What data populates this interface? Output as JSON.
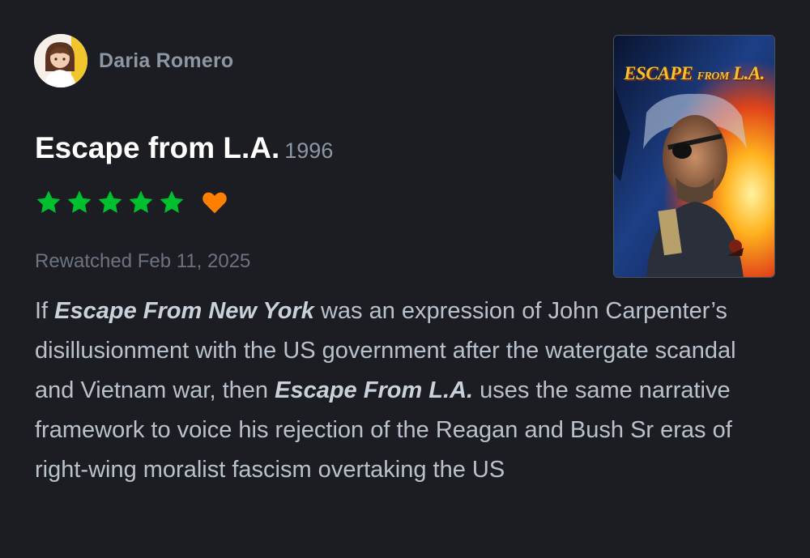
{
  "review": {
    "author": "Daria Romero",
    "film_title": "Escape from L.A.",
    "year": "1996",
    "rating_stars": 5,
    "liked": true,
    "watch_status": "Rewatched Feb 11, 2025",
    "body": {
      "p1": "If ",
      "b1": "Escape From New York",
      "p2": " was an expression of John Carpenter’s disillusionment with the US government after the watergate scandal and Vietnam war, then ",
      "b2": "Escape From L.A.",
      "p3": " uses the same narrative framework to voice his rejection of the Reagan and Bush Sr eras of right-wing moralist fascism overtaking the US"
    }
  },
  "poster": {
    "title_main": "ESCAPE",
    "title_small": "FROM",
    "title_end": "L.A."
  },
  "colors": {
    "background": "#1b1d22",
    "star": "#00c030",
    "heart": "#ff8000",
    "username": "#8d97a4",
    "body_text": "#b9c2cc"
  },
  "icons": {
    "star": "star-icon",
    "heart": "heart-icon",
    "avatar": "avatar"
  }
}
